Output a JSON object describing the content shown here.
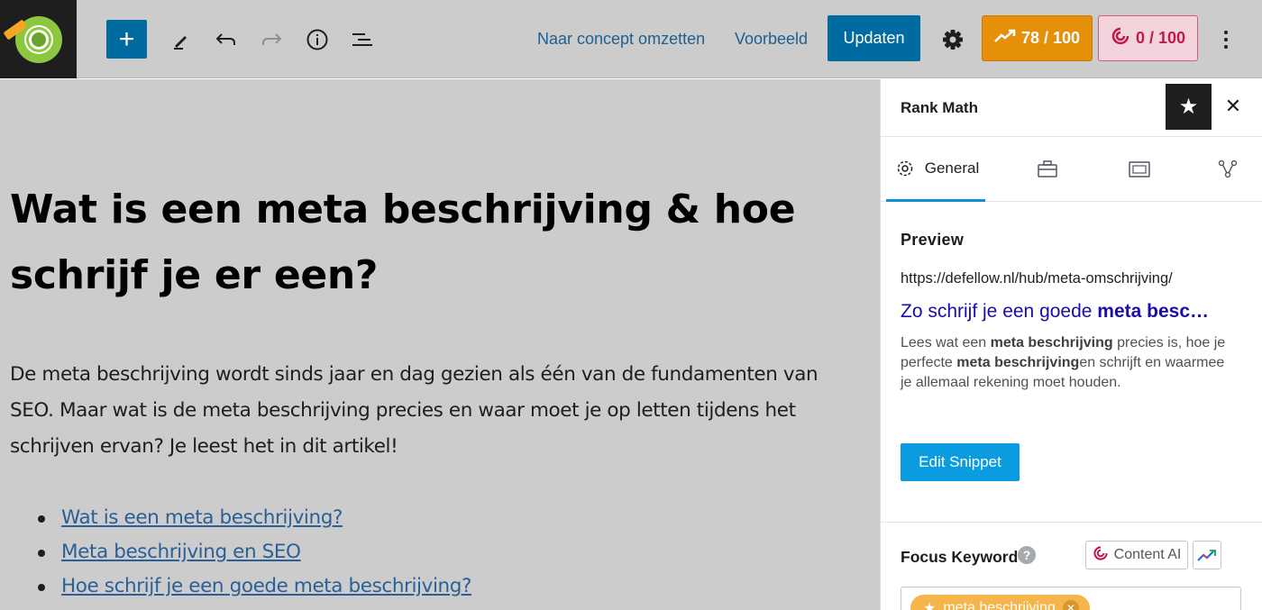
{
  "topbar": {
    "add_label": "+",
    "revert_label": "Naar concept omzetten",
    "preview_label": "Voorbeeld",
    "update_label": "Updaten",
    "seo_score": "78 / 100",
    "ai_score": "0 / 100",
    "icons": [
      "rank-math-logo-icon",
      "pencil-icon",
      "undo-icon",
      "redo-icon",
      "info-icon",
      "list-view-icon",
      "gear-icon",
      "more-vertical-icon"
    ]
  },
  "post": {
    "title": "Wat is een meta beschrijving & hoe schrijf je er een?",
    "intro": "De meta beschrijving wordt sinds jaar en dag gezien als één van de fundamenten van SEO. Maar wat is de meta beschrijving precies en waar moet je op letten tijdens het schrijven ervan? Je leest het in dit artikel!",
    "toc": [
      "Wat is een meta beschrijving?",
      "Meta beschrijving en SEO",
      "Hoe schrijf je een goede meta beschrijving?"
    ]
  },
  "sidebar": {
    "title": "Rank Math",
    "tab_general": "General",
    "preview_label": "Preview",
    "serp_url": "https://defellow.nl/hub/meta-omschrijving/",
    "serp_title_plain": "Zo schrijf je een goede ",
    "serp_title_bold": "meta besc…",
    "serp_desc_1": "Lees wat een ",
    "serp_desc_b1": "meta beschrijving",
    "serp_desc_2": " precies is, hoe je perfecte ",
    "serp_desc_b2": "meta beschrijving",
    "serp_desc_3": "en schrijft en waarmee je allemaal rekening moet houden.",
    "edit_snippet": "Edit Snippet",
    "focus_keyword_label": "Focus Keyword",
    "content_ai_label": "Content AI",
    "keyword": "meta beschrijving"
  },
  "colors": {
    "accent_blue": "#006ba1",
    "seo_score_bg": "#e6900a",
    "ai_score_text": "#c0194c",
    "serp_title": "#1a0dab",
    "keyword_tag": "#f6b54b"
  }
}
